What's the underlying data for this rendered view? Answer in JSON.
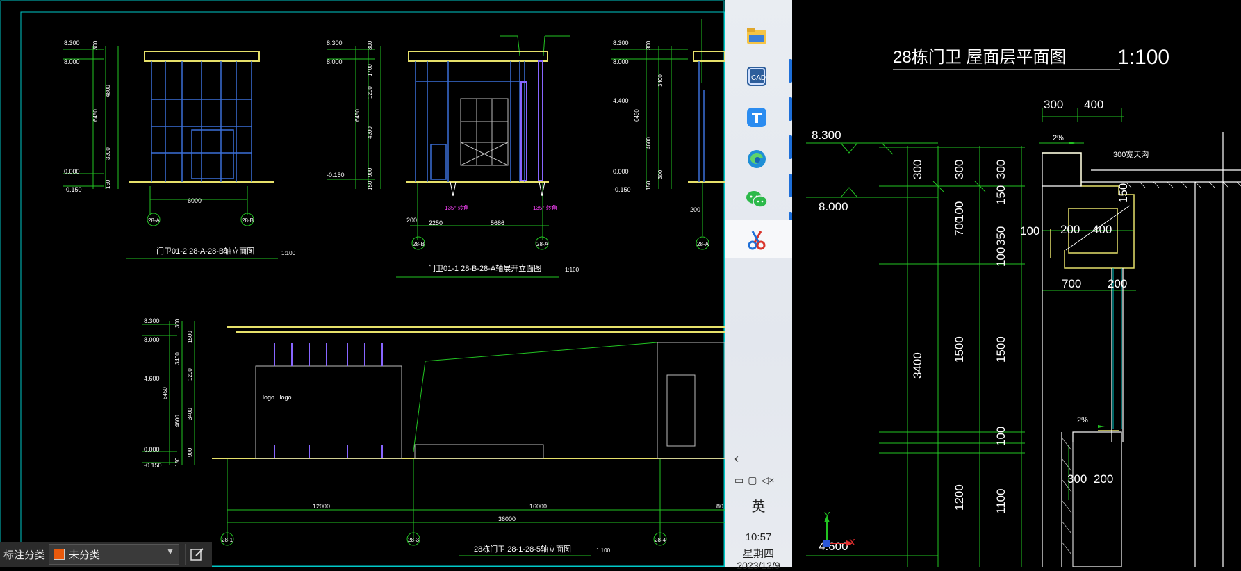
{
  "left_drawing": {
    "elevation1": {
      "levels": [
        "8.300",
        "8.000",
        "0.000",
        "-0.150"
      ],
      "dims": [
        "300",
        "6450",
        "4800",
        "3200",
        "150"
      ],
      "width_dim": "6000",
      "axes": [
        "28-A",
        "28-B"
      ],
      "title": "门卫01-2  28-A-28-B轴立面图",
      "scale": "1:100"
    },
    "elevation2": {
      "levels": [
        "8.300",
        "8.000",
        "-0.150"
      ],
      "dims": [
        "300",
        "1700",
        "1200",
        "4200",
        "6450",
        "900",
        "150"
      ],
      "width_dims": [
        "2250",
        "5686"
      ],
      "side_dim": "200",
      "axes": [
        "28-B",
        "28-A"
      ],
      "angles": [
        "135° 转角",
        "135° 转角"
      ],
      "title": "门卫01-1  28-B-28-A轴展开立面图",
      "scale": "1:100"
    },
    "elevation3": {
      "levels": [
        "8.300",
        "8.000",
        "4.400",
        "0.000",
        "-0.150"
      ],
      "dims": [
        "300",
        "3400",
        "6450",
        "4600",
        "300",
        "150"
      ],
      "side_dim": "200",
      "axis": "28-A"
    },
    "elevation4": {
      "levels": [
        "8.300",
        "8.000",
        "4.600",
        "0.000",
        "-0.150"
      ],
      "dims": [
        "300",
        "1500",
        "3400",
        "1200",
        "6450",
        "3400",
        "4600",
        "900",
        "150"
      ],
      "logo_text": "logo...logo",
      "width_dims": [
        "12000",
        "16000",
        "36000"
      ],
      "edge_dim": "80",
      "axes": [
        "28-1",
        "28-3",
        "28-4"
      ],
      "title": "28栋门卫  28-1-28-5轴立面图",
      "scale": "1:100"
    }
  },
  "right_drawing": {
    "title": "28栋门卫   屋面层平面图",
    "scale": "1:100",
    "levels": [
      "8.300",
      "8.000",
      "4.600"
    ],
    "dims_top": [
      "300",
      "400"
    ],
    "slope_top": "2%",
    "slope_mid": "2%",
    "note_300": "300宽天沟",
    "dims_mid": [
      "200",
      "400",
      "100",
      "150"
    ],
    "dims_lower": [
      "700",
      "200"
    ],
    "dims_bottom": [
      "300",
      "200"
    ],
    "vertical_col1": [
      "300",
      "3400"
    ],
    "vertical_col2": [
      "300",
      "700",
      "100",
      "1500",
      "1200"
    ],
    "vertical_col3": [
      "300",
      "150",
      "350",
      "100",
      "1500",
      "100",
      "1100"
    ],
    "axis_y": "Y",
    "axis_x": "X"
  },
  "taskbar": {
    "icons": [
      "folder-icon",
      "cad-icon",
      "text-app-icon",
      "edge-icon",
      "wechat-icon",
      "snip-icon"
    ],
    "ime": "英",
    "time": "10:57",
    "weekday": "星期四",
    "date": "2023/12/9"
  },
  "statusbar": {
    "label": "标注分类",
    "layer": "未分类",
    "layer_color": "#e8590c"
  },
  "colors": {
    "cad_green": "#22c322",
    "cad_yellow": "#e6e06a",
    "cad_white": "#ffffff",
    "cad_cyan": "#00c8c8",
    "cad_purple": "#8866ff",
    "taskbar_bg": "#e6eaef"
  }
}
